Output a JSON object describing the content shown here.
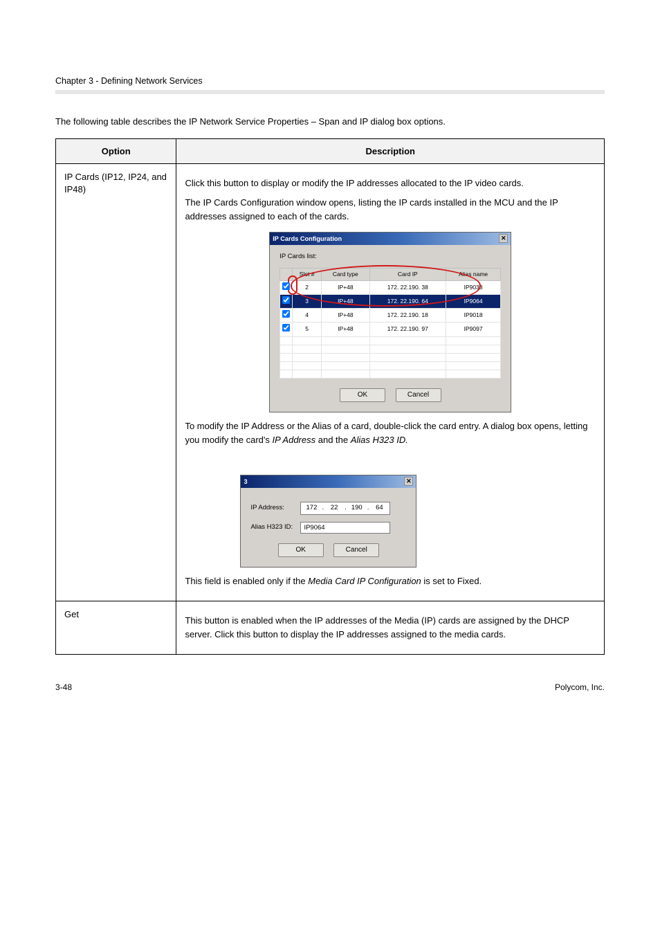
{
  "header": {
    "chapter_line": "Chapter 3 - Defining Network Services",
    "intro": "The following table describes the IP Network Service Properties – Span and IP dialog box options."
  },
  "table": {
    "col1_header": "Option",
    "col2_header": "Description",
    "row1": {
      "option": "IP Cards (IP12, IP24, and IP48)",
      "p1": "Click this button to display or modify the IP addresses allocated to the IP video cards.",
      "p2": "The IP Cards Configuration window opens, listing the IP cards installed in the MCU and the IP addresses assigned to each of the cards.",
      "p3a": "To modify the IP Address or the Alias of a card, double-click the card entry. A dialog box opens, letting you modify the card's ",
      "p3_em1": "IP Address",
      "p3b": " and the ",
      "p3_em2": "Alias H323 ID.",
      "p4a": "This field is enabled only if the ",
      "p4_em": "Media Card IP Configuration",
      "p4b": " is set to Fixed."
    },
    "row2": {
      "option": "Get",
      "text": "This button is enabled when the IP addresses of the Media (IP) cards are assigned by the DHCP server. Click this button to display the IP addresses assigned to the media cards."
    }
  },
  "dlg1": {
    "title": "IP Cards Configuration",
    "list_label": "IP Cards list:",
    "cols": {
      "slot": "Slot #",
      "ctype": "Card type",
      "cip": "Card IP",
      "alias": "Alias name"
    },
    "rows": [
      {
        "slot": "2",
        "ctype": "IP+48",
        "cip": "172. 22.190. 38",
        "alias": "IP9038",
        "sel": false
      },
      {
        "slot": "3",
        "ctype": "IP+48",
        "cip": "172. 22.190. 64",
        "alias": "IP9064",
        "sel": true
      },
      {
        "slot": "4",
        "ctype": "IP+48",
        "cip": "172. 22.190. 18",
        "alias": "IP9018",
        "sel": false
      },
      {
        "slot": "5",
        "ctype": "IP+48",
        "cip": "172. 22.190. 97",
        "alias": "IP9097",
        "sel": false
      }
    ],
    "ok": "OK",
    "cancel": "Cancel"
  },
  "dlg2": {
    "title": "3",
    "ip_label": "IP Address:",
    "ip_value": {
      "a": "172",
      "b": "22",
      "c": "190",
      "d": "64"
    },
    "alias_label": "Alias H323 ID:",
    "alias_value": "IP9064",
    "ok": "OK",
    "cancel": "Cancel"
  },
  "footer": {
    "left": "3-48",
    "right": "Polycom, Inc."
  }
}
